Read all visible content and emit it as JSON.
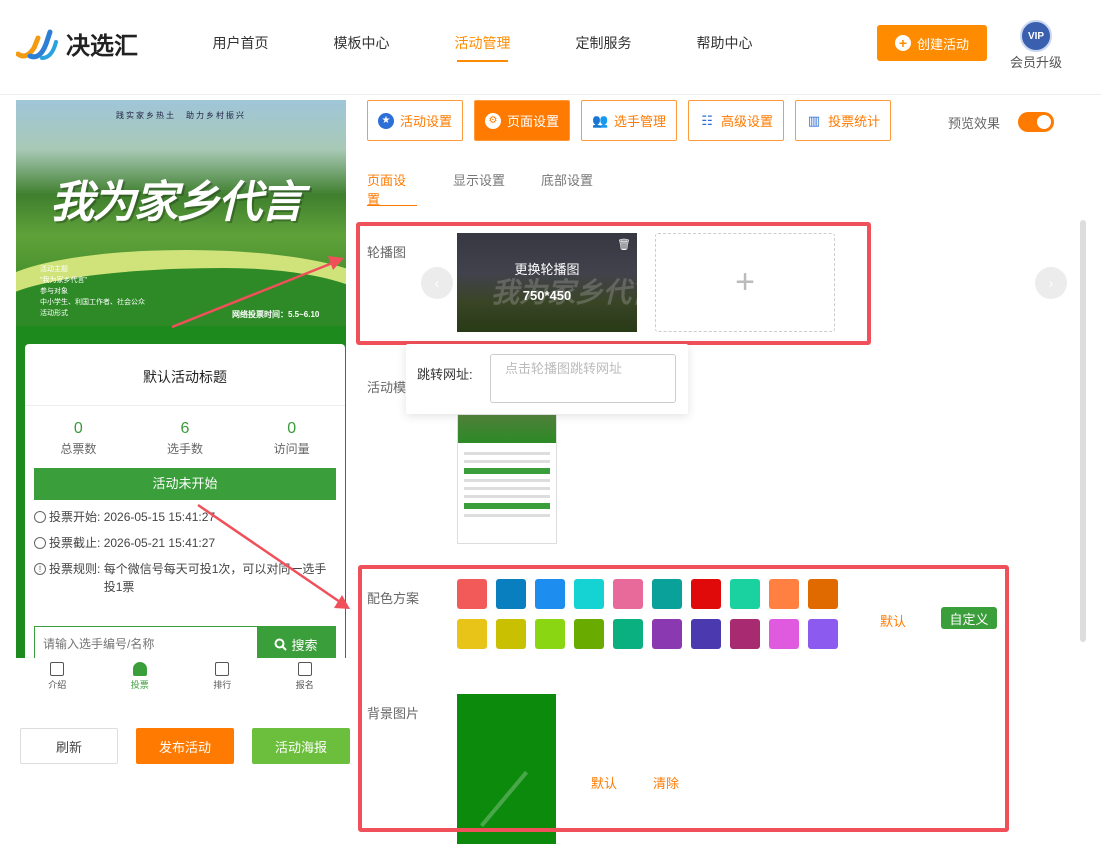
{
  "brand": {
    "name": "决选汇"
  },
  "nav": [
    {
      "label": "用户首页",
      "active": false
    },
    {
      "label": "模板中心",
      "active": false
    },
    {
      "label": "活动管理",
      "active": true
    },
    {
      "label": "定制服务",
      "active": false
    },
    {
      "label": "帮助中心",
      "active": false
    }
  ],
  "header": {
    "create_label": "创建活动",
    "vip_badge": "VIP",
    "vip_label": "会员升级"
  },
  "preview_phone": {
    "banner": {
      "top_text": "践实家乡热土　助力乡村振兴",
      "slogan": "我为家乡代言",
      "info_lines": [
        "活动主题",
        "\"我为家乡代言\"",
        "参与对象",
        "中小学生、利国工作者、社会公众",
        "活动形式"
      ],
      "vote_time": "网络投票时间：5.5~6.10"
    },
    "title": "默认活动标题",
    "stats": [
      {
        "value": "0",
        "label": "总票数"
      },
      {
        "value": "6",
        "label": "选手数"
      },
      {
        "value": "0",
        "label": "访问量"
      }
    ],
    "status": "活动未开始",
    "info": [
      {
        "label": "投票开始:",
        "value": "2026-05-15 15:41:27"
      },
      {
        "label": "投票截止:",
        "value": "2026-05-21 15:41:27"
      },
      {
        "label": "投票规则:",
        "value": "每个微信号每天可投1次，可以对同一选手投1票"
      }
    ],
    "search": {
      "placeholder": "请输入选手编号/名称",
      "button": "搜索"
    },
    "tabs": [
      {
        "label": "介绍",
        "active": false
      },
      {
        "label": "投票",
        "active": true
      },
      {
        "label": "排行",
        "active": false
      },
      {
        "label": "报名",
        "active": false
      }
    ]
  },
  "actions": {
    "refresh": "刷新",
    "publish": "发布活动",
    "poster": "活动海报"
  },
  "settings_tabs": [
    {
      "label": "活动设置",
      "icon": "star-icon",
      "active": false
    },
    {
      "label": "页面设置",
      "icon": "gear-icon",
      "active": true
    },
    {
      "label": "选手管理",
      "icon": "users-icon",
      "active": false
    },
    {
      "label": "高级设置",
      "icon": "sliders-icon",
      "active": false
    },
    {
      "label": "投票统计",
      "icon": "bar-chart-icon",
      "active": false
    }
  ],
  "preview_toggle": {
    "label": "预览效果",
    "on": true
  },
  "sub_tabs": [
    {
      "label": "页面设置",
      "active": true
    },
    {
      "label": "显示设置",
      "active": false
    },
    {
      "label": "底部设置",
      "active": false
    }
  ],
  "carousel": {
    "label": "轮播图",
    "replace_text": "更换轮播图",
    "size_text": "750*450",
    "add_symbol": "+"
  },
  "jump_url": {
    "label": "跳转网址:",
    "placeholder": "点击轮播图跳转网址"
  },
  "template": {
    "label": "活动模"
  },
  "color_scheme": {
    "label": "配色方案",
    "colors": [
      "#f25a5a",
      "#0a7fbf",
      "#1d8ef0",
      "#16d3d3",
      "#e86a9a",
      "#0aa19a",
      "#e00a0a",
      "#1ad1a0",
      "#ff8040",
      "#e06a00",
      "#e8c419",
      "#c8c000",
      "#8bd612",
      "#6aab00",
      "#0ab080",
      "#8a39b0",
      "#4b39b0",
      "#a82a70",
      "#e05ae0",
      "#8d5af0"
    ],
    "default_label": "默认",
    "custom_label": "自定义"
  },
  "background": {
    "label": "背景图片",
    "default_label": "默认",
    "clear_label": "清除"
  },
  "colors": {
    "accent": "#ff7a00",
    "green": "#3a9e3a",
    "highlight": "#f0505a"
  }
}
